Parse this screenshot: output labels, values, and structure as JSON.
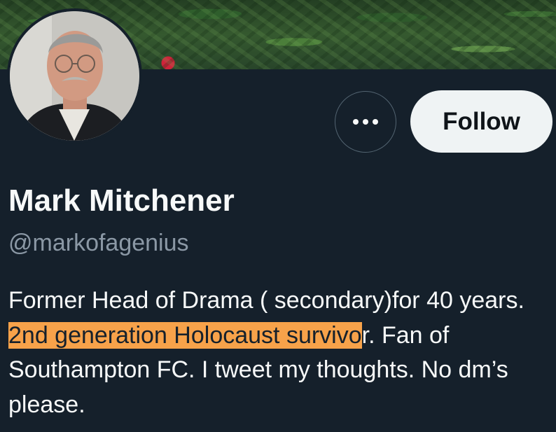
{
  "profile": {
    "display_name": "Mark Mitchener",
    "handle": "@markofagenius",
    "bio": {
      "before_highlight": "Former Head of Drama ( secondary)for 40 years. ",
      "highlight": "2nd generation  Holocaust survivo",
      "after_highlight": "r. Fan of Southampton FC. I tweet my thoughts. No dm’s please."
    }
  },
  "actions": {
    "more_icon": "more-horizontal-icon",
    "follow_label": "Follow"
  },
  "colors": {
    "background": "#15202b",
    "follow_button_bg": "#eff3f4",
    "handle_text": "#8b98a5",
    "highlight": "#f7a24a"
  }
}
